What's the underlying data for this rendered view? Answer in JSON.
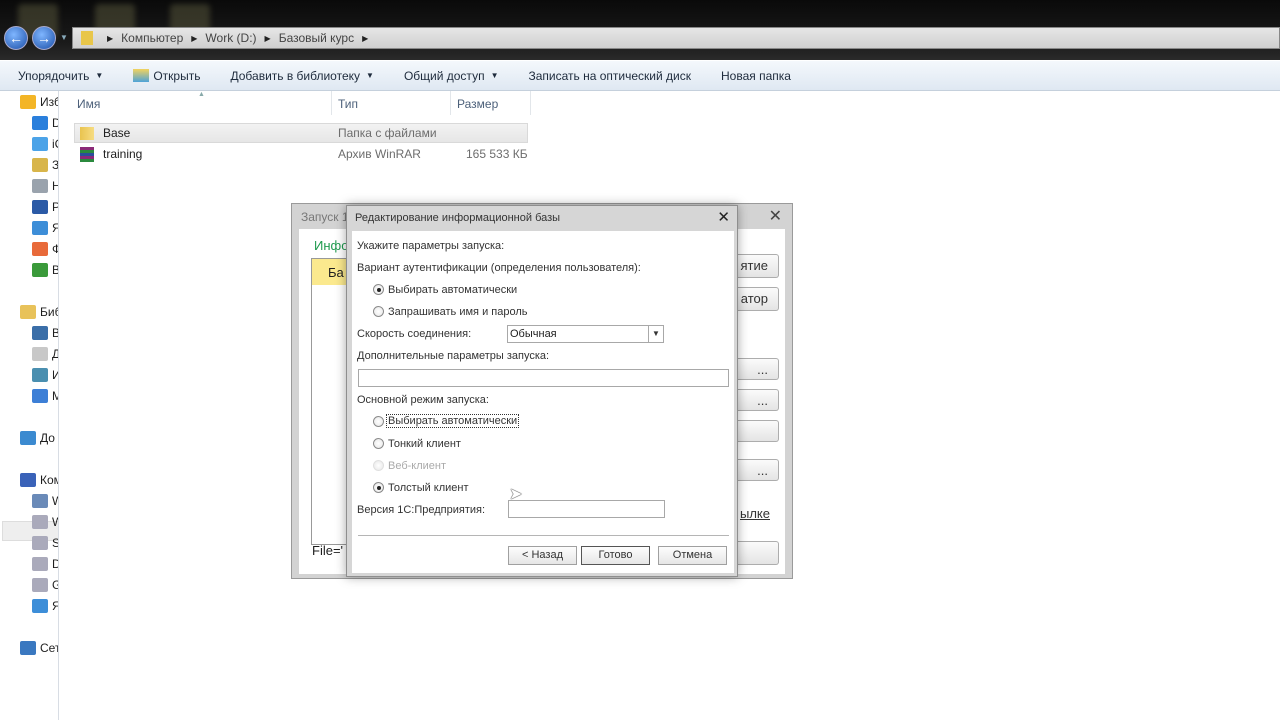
{
  "address": {
    "crumbs": [
      "Компьютер",
      "Work (D:)",
      "Базовый курс"
    ]
  },
  "toolbar": {
    "organize": "Упорядочить",
    "open": "Открыть",
    "add_library": "Добавить в библиотеку",
    "share": "Общий доступ",
    "burn": "Записать на оптический диск",
    "new_folder": "Новая папка"
  },
  "sidebar": {
    "items": [
      "Изб",
      "D",
      "iC",
      "З",
      "Н",
      "Р",
      "Я",
      "Ф",
      "В",
      "Биб",
      "В",
      "Д",
      "И",
      "М",
      "До",
      "Ком",
      "W",
      "W",
      "S",
      "D",
      "G",
      "Я",
      "Сет"
    ]
  },
  "columns": {
    "name": "Имя",
    "type": "Тип",
    "size": "Размер"
  },
  "files": [
    {
      "name": "Base",
      "type": "Папка с файлами",
      "size": ""
    },
    {
      "name": "training",
      "type": "Архив WinRAR",
      "size": "165 533 КБ"
    }
  ],
  "back_dialog": {
    "title": "Запуск 1",
    "section": "Инфо",
    "list_item": "Ба",
    "btn1": "ятие",
    "btn2": "атор",
    "btn_dots": "...",
    "link": "ылке",
    "path": "File='"
  },
  "dialog": {
    "title": "Редактирование информационной базы",
    "intro": "Укажите параметры запуска:",
    "auth_label": "Вариант аутентификации (определения пользователя):",
    "auth_options": [
      "Выбирать автоматически",
      "Запрашивать имя и пароль"
    ],
    "auth_selected": 0,
    "speed_label": "Скорость соединения:",
    "speed_value": "Обычная",
    "extra_label": "Дополнительные параметры запуска:",
    "extra_value": "",
    "mode_label": "Основной режим запуска:",
    "mode_options": [
      "Выбирать автоматически",
      "Тонкий клиент",
      "Веб-клиент",
      "Толстый клиент"
    ],
    "mode_selected": 3,
    "version_label": "Версия 1С:Предприятия:",
    "version_value": "",
    "back": "< Назад",
    "done": "Готово",
    "cancel": "Отмена"
  }
}
